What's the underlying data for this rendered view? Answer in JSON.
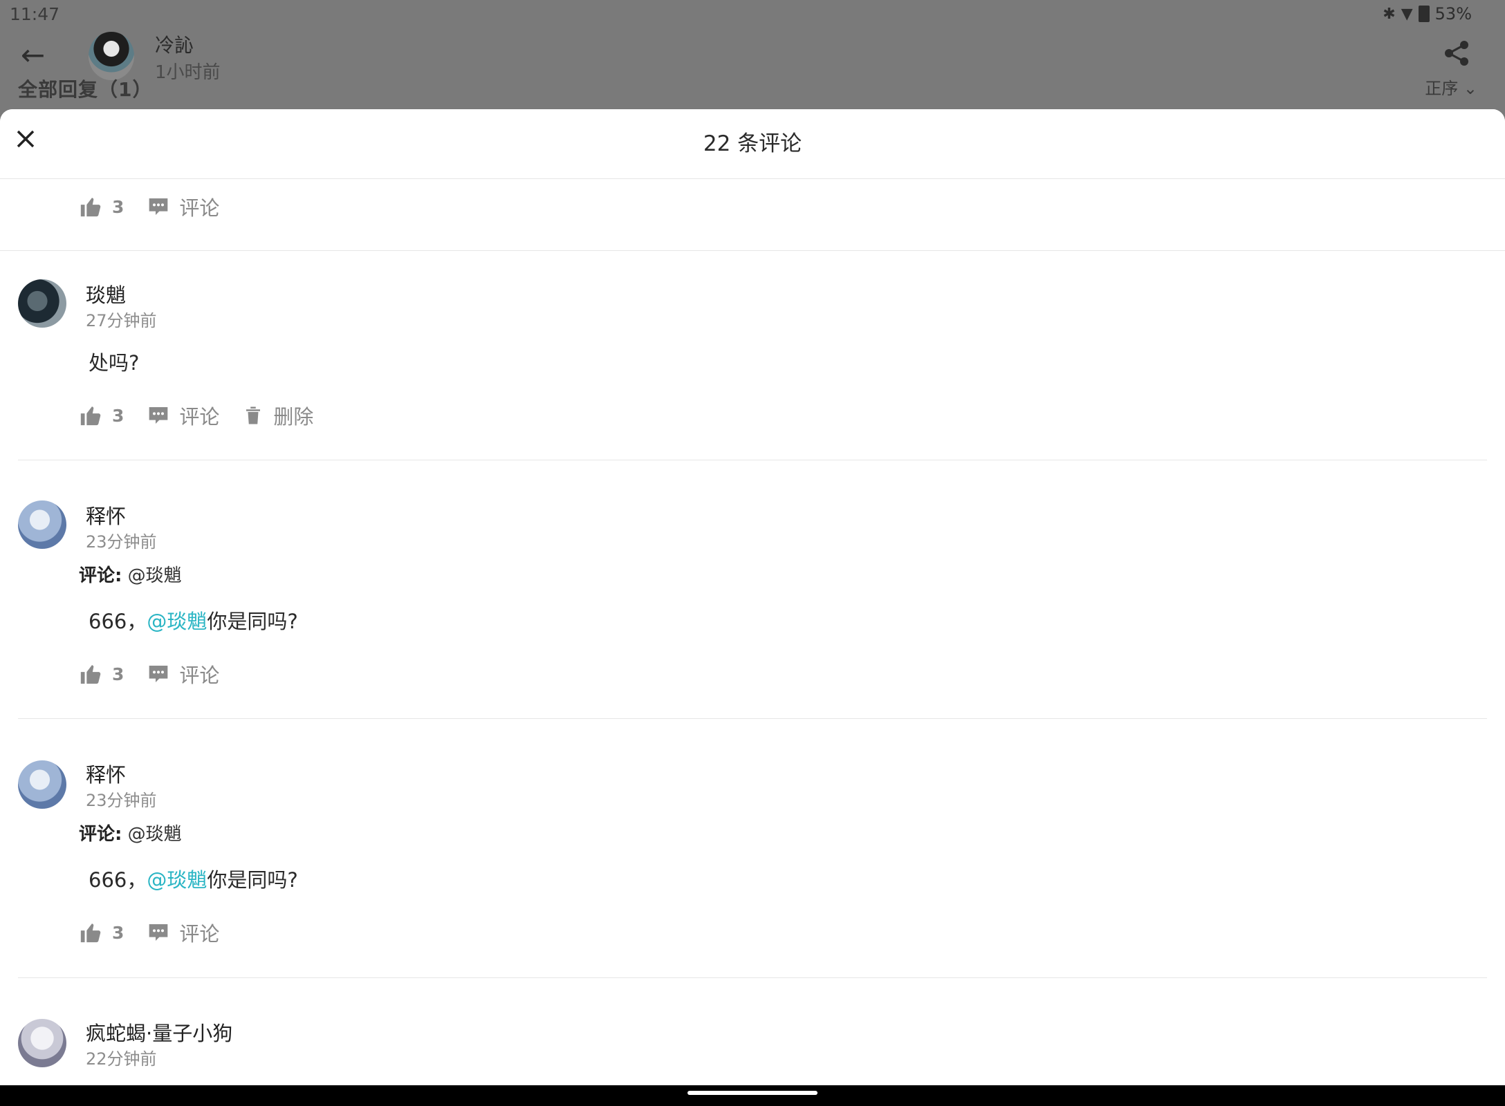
{
  "status_bar": {
    "time": "11:47",
    "battery": "53%"
  },
  "post": {
    "author": "冷訫",
    "time": "1小时前",
    "under_left": "全部回复（1）",
    "under_right": "正序"
  },
  "sheet": {
    "title": "22 条评论"
  },
  "comments": [
    {
      "likes": "3",
      "comment_label": "评论"
    },
    {
      "name": "琰魈",
      "time": "27分钟前",
      "body": "处吗?",
      "likes": "3",
      "comment_label": "评论",
      "delete_label": "删除"
    },
    {
      "name": "释怀",
      "time": "23分钟前",
      "reply_label": "评论:",
      "reply_target": "@琰魈",
      "body_prefix": "666，",
      "mention": "@琰魈",
      "body_suffix": "你是同吗?",
      "likes": "3",
      "comment_label": "评论"
    },
    {
      "name": "释怀",
      "time": "23分钟前",
      "reply_label": "评论:",
      "reply_target": "@琰魈",
      "body_prefix": "666，",
      "mention": "@琰魈",
      "body_suffix": "你是同吗?",
      "likes": "3",
      "comment_label": "评论"
    },
    {
      "name": "疯蛇蝎·量子小狗",
      "time": "22分钟前"
    }
  ],
  "icons": {
    "like": "thumbs-up-icon",
    "comment": "chat-bubble-icon",
    "delete": "trash-icon",
    "close": "close-icon",
    "share": "share-icon",
    "back": "arrow-left-icon"
  },
  "colors": {
    "mention": "#2ab5c4",
    "icon_gray": "#8a8a8a",
    "overlay": "#7a7a7a"
  }
}
